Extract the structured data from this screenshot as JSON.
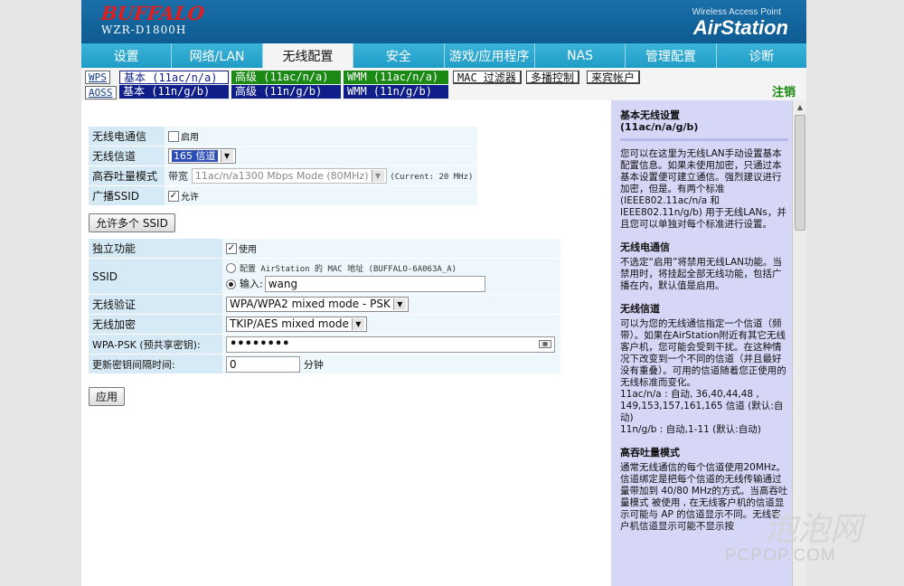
{
  "header": {
    "logo": "BUFFALO",
    "model": "WZR-D1800H",
    "brand_sub": "Wireless Access Point",
    "brand_main": "AirStation"
  },
  "main_nav": [
    "设置",
    "网络/LAN",
    "无线配置",
    "安全",
    "游戏/应用程序",
    "NAS",
    "管理配置",
    "诊断"
  ],
  "sub_nav": {
    "wps": "WPS",
    "aoss": "AOSS",
    "basic_ac": "基本 (11ac/n/a)",
    "advanced_ac": "高级 (11ac/n/a)",
    "wmm_ac": "WMM (11ac/n/a)",
    "basic_ng": "基本 (11n/g/b)",
    "advanced_ng": "高级 (11n/g/b)",
    "wmm_ng": "WMM (11n/g/b)",
    "mac_filter": "MAC 过滤器",
    "multicast": "多播控制",
    "guest": "来宾帐户",
    "logout": "注销"
  },
  "form1": {
    "radio_label": "无线电通信",
    "radio_enable": "启用",
    "channel_label": "无线信道",
    "channel_value": "165 信道",
    "throughput_label": "高吞吐量模式",
    "bandwidth_label": "带宽",
    "bandwidth_value": "11ac/n/a1300 Mbps Mode (80MHz)",
    "current": "(Current: 20 MHz)",
    "broadcast_label": "广播SSID",
    "broadcast_allow": "允许",
    "multi_ssid_button": "允许多个 SSID"
  },
  "form2": {
    "separate_label": "独立功能",
    "separate_use": "使用",
    "ssid_label": "SSID",
    "ssid_opt1": "配置 AirStation 的 MAC 地址 (BUFFALO-6A063A_A)",
    "ssid_opt2": "输入:",
    "ssid_value": "wang",
    "auth_label": "无线验证",
    "auth_value": "WPA/WPA2 mixed mode - PSK",
    "enc_label": "无线加密",
    "enc_value": "TKIP/AES mixed mode",
    "psk_label": "WPA-PSK (预共享密钥):",
    "psk_value": "••••••••",
    "rekey_label": "更新密钥间隔时间:",
    "rekey_value": "0",
    "rekey_unit": "分钟",
    "apply_button": "应用"
  },
  "help": {
    "title1": "基本无线设置",
    "title2": "(11ac/n/a/g/b)",
    "p_intro": "您可以在这里为无线LAN手动设置基本配置信息。如果未使用加密，只通过本基本设置便可建立通信。强烈建议进行加密，但是。有两个标准 (IEEE802.11ac/n/a 和 IEEE802.11n/g/b) 用于无线LANs，并且您可以单独对每个标准进行设置。",
    "h_radio": "无线电通信",
    "p_radio": "不选定“启用”将禁用无线LAN功能。当禁用时，将挂起全部无线功能，包括广播在内，默认值是启用。",
    "h_channel": "无线信道",
    "p_channel": "可以为您的无线通信指定一个信道（频带）。如果在AirStation附近有其它无线客户机，您可能会受到干扰。在这种情况下改变到一个不同的信道（并且最好没有重叠）。可用的信道随着您正使用的无线标准而变化。",
    "p_channel_a": "11ac/n/a : 自动, 36,40,44,48 , 149,153,157,161,165 信道 (默认:自动)",
    "p_channel_g": "11n/g/b : 自动,1-11 (默认:自动)",
    "h_throughput": "高吞吐量模式",
    "p_throughput": "通常无线通信的每个信道使用20MHz。信道绑定是把每个信道的无线传输通过量带加到 40/80 MHz的方式。当高吞吐量模式 被使用 , 在无线客户机的信道显示可能与 AP 的信道显示不同。无线客户机信道显示可能不显示按"
  },
  "watermark": {
    "cn": "泡泡网",
    "en": "PCPOP.COM"
  },
  "colors": {
    "header_blue": "#0d5b92",
    "nav_cyan": "#27a7cf",
    "sub_blue": "#0f1e88",
    "sub_green": "#1a8a14",
    "help_bg": "#d6d6f7",
    "logo_red": "#e41c1c"
  }
}
